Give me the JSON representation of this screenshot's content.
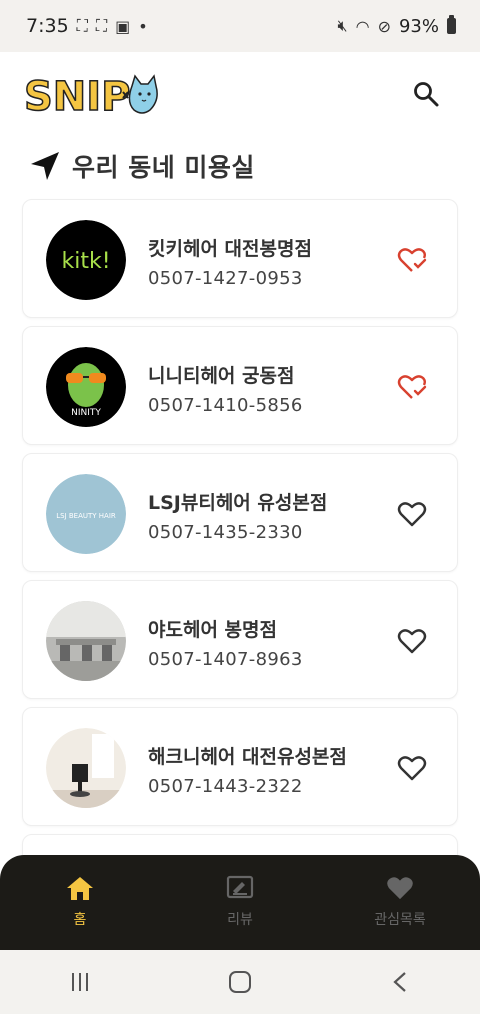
{
  "status_bar": {
    "time": "7:35",
    "battery": "93%"
  },
  "header": {
    "logo_text": "SNIP"
  },
  "section": {
    "title": "우리 동네 미용실"
  },
  "salons": [
    {
      "name": "킷키헤어 대전봉명점",
      "phone": "0507-1427-0953",
      "favorited": true,
      "logo_text": "kitk!",
      "logo_bg": "#000000",
      "logo_fg": "#a8e04a"
    },
    {
      "name": "니니티헤어 궁동점",
      "phone": "0507-1410-5856",
      "favorited": true,
      "logo_text": "NINITY",
      "logo_bg": "#000000",
      "logo_fg": "#6fbf3a"
    },
    {
      "name": "LSJ뷰티헤어 유성본점",
      "phone": "0507-1435-2330",
      "favorited": false,
      "logo_text": "LSJ BEAUTY HAIR",
      "logo_bg": "#9fc4d4",
      "logo_fg": "#ffffff"
    },
    {
      "name": "야도헤어 봉명점",
      "phone": "0507-1407-8963",
      "favorited": false
    },
    {
      "name": "해크니헤어 대전유성본점",
      "phone": "0507-1443-2322",
      "favorited": false
    }
  ],
  "bottom_nav": [
    {
      "label": "홈",
      "icon": "home-icon",
      "active": true
    },
    {
      "label": "리뷰",
      "icon": "review-icon",
      "active": false
    },
    {
      "label": "관심목록",
      "icon": "heart-icon",
      "active": false
    }
  ],
  "colors": {
    "accent": "#f4c542",
    "favorite": "#d8412f",
    "nav_bg": "#1c1b17"
  }
}
